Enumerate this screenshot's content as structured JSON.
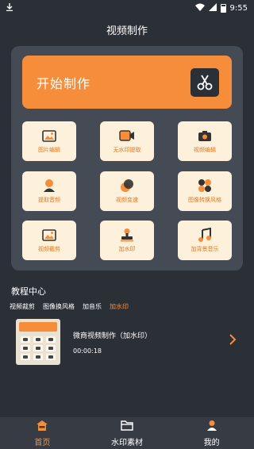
{
  "status_bar": {
    "time": "9:55",
    "icons": [
      "download-icon",
      "wifi-icon",
      "signal-icon",
      "battery-icon"
    ]
  },
  "page_title": "视频制作",
  "start_card": {
    "label": "开始制作",
    "icon": "scissors-icon"
  },
  "tools": [
    {
      "label": "图片编辑",
      "icon": "image-icon"
    },
    {
      "label": "无水印提取",
      "icon": "video-camera-icon"
    },
    {
      "label": "视频编辑",
      "icon": "camera-icon"
    },
    {
      "label": "提取音频",
      "icon": "person-icon"
    },
    {
      "label": "视频变速",
      "icon": "speed-circles-icon"
    },
    {
      "label": "图像转换风格",
      "icon": "flower-icon"
    },
    {
      "label": "视频截剪",
      "icon": "image-icon"
    },
    {
      "label": "加水印",
      "icon": "stamp-icon"
    },
    {
      "label": "加背景音乐",
      "icon": "music-note-icon"
    }
  ],
  "tutorial": {
    "section_title": "教程中心",
    "tabs": [
      "视频裁剪",
      "图像换风格",
      "加音乐",
      "加水印"
    ],
    "active_tab": "加水印",
    "item": {
      "title": "微商视频制作（加水印）",
      "duration": "00:00:18",
      "icon": "chevron-right-icon"
    }
  },
  "bottom_nav": [
    {
      "label": "首页",
      "icon": "home-icon",
      "active": true
    },
    {
      "label": "水印素材",
      "icon": "folder-icon",
      "active": false
    },
    {
      "label": "我的",
      "icon": "user-icon",
      "active": false
    }
  ],
  "colors": {
    "accent": "#f68d3a",
    "background": "#2b2f36",
    "panel": "#444b55",
    "tile": "#fdf1dc"
  }
}
